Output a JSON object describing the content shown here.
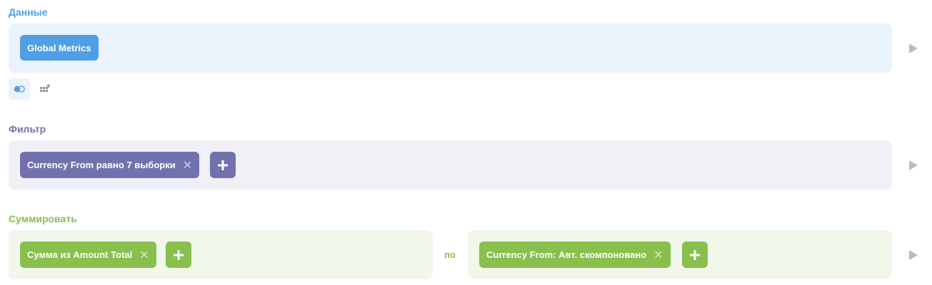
{
  "data_section": {
    "label": "Данные",
    "source_pill": "Global Metrics"
  },
  "filter_section": {
    "label": "Фильтр",
    "filter_pill": "Currency From равно 7 выборки"
  },
  "summarize_section": {
    "label": "Суммировать",
    "metric_pill": "Сумма из Amount Total",
    "by_label": "по",
    "breakout_pill": "Currency From: Авт. скомпоновано"
  },
  "icons": {
    "toggle": "toggle-icon",
    "custom_columns": "add-grid-icon",
    "remove": "close-icon",
    "add": "plus-icon",
    "expand": "play-arrow-icon"
  },
  "colors": {
    "data_accent": "#509ee3",
    "data_bg": "#eaf2fb",
    "filter_accent": "#7172ad",
    "filter_bg": "#f0f0f7",
    "summarize_accent": "#88bf4d",
    "summarize_bg": "#f1f7ea"
  }
}
